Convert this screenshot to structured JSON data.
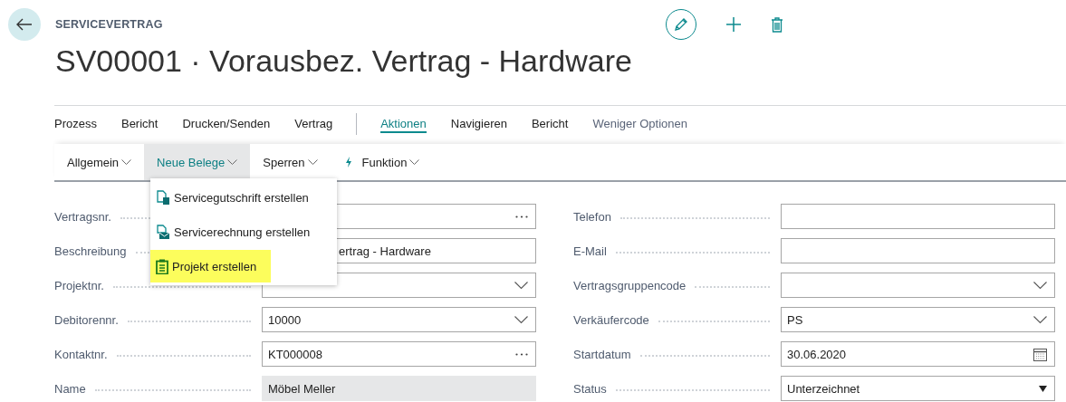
{
  "header": {
    "caption": "SERVICEVERTRAG",
    "title": "SV00001 · Vorausbez. Vertrag - Hardware"
  },
  "action_groups": [
    [
      {
        "label": "Prozess",
        "selected": false
      },
      {
        "label": "Bericht",
        "selected": false
      },
      {
        "label": "Drucken/Senden",
        "selected": false
      },
      {
        "label": "Vertrag",
        "selected": false
      }
    ],
    [
      {
        "label": "Aktionen",
        "selected": true
      },
      {
        "label": "Navigieren",
        "selected": false
      },
      {
        "label": "Bericht",
        "selected": false
      }
    ]
  ],
  "less_options": "Weniger Optionen",
  "sub_actions": [
    {
      "label": "Allgemein",
      "selected": false,
      "kind": "plain"
    },
    {
      "label": "Neue Belege",
      "selected": true,
      "kind": "plain"
    },
    {
      "label": "Sperren",
      "selected": false,
      "kind": "plain"
    },
    {
      "label": "Funktion",
      "selected": false,
      "kind": "bolt"
    }
  ],
  "dropdown_menu": [
    {
      "label": "Servicegutschrift erstellen",
      "kind": "credit",
      "highlighted": false
    },
    {
      "label": "Servicerechnung erstellen",
      "kind": "invoice",
      "highlighted": false
    },
    {
      "label": "Projekt erstellen",
      "kind": "project",
      "highlighted": true
    }
  ],
  "fields_left": [
    {
      "label": "Vertragsnr.",
      "kind": "lookup"
    },
    {
      "label": "Beschreibung",
      "value": "ertrag - Hardware",
      "kind": "text",
      "partly_covered": true
    },
    {
      "label": "Projektnr.",
      "kind": "dropdown"
    },
    {
      "label": "Debitorennr.",
      "value": "10000",
      "kind": "dropdown"
    },
    {
      "label": "Kontaktnr.",
      "value": "KT000008",
      "kind": "lookup"
    },
    {
      "label": "Name",
      "value": "Möbel Meller",
      "kind": "readonly"
    }
  ],
  "fields_right": [
    {
      "label": "Telefon",
      "kind": "text"
    },
    {
      "label": "E-Mail",
      "kind": "text"
    },
    {
      "label": "Vertragsgruppencode",
      "kind": "dropdown"
    },
    {
      "label": "Verkäufercode",
      "value": "PS",
      "kind": "dropdown"
    },
    {
      "label": "Startdatum",
      "value": "30.06.2020",
      "kind": "date"
    },
    {
      "label": "Status",
      "value": "Unterzeichnet",
      "kind": "select"
    }
  ]
}
